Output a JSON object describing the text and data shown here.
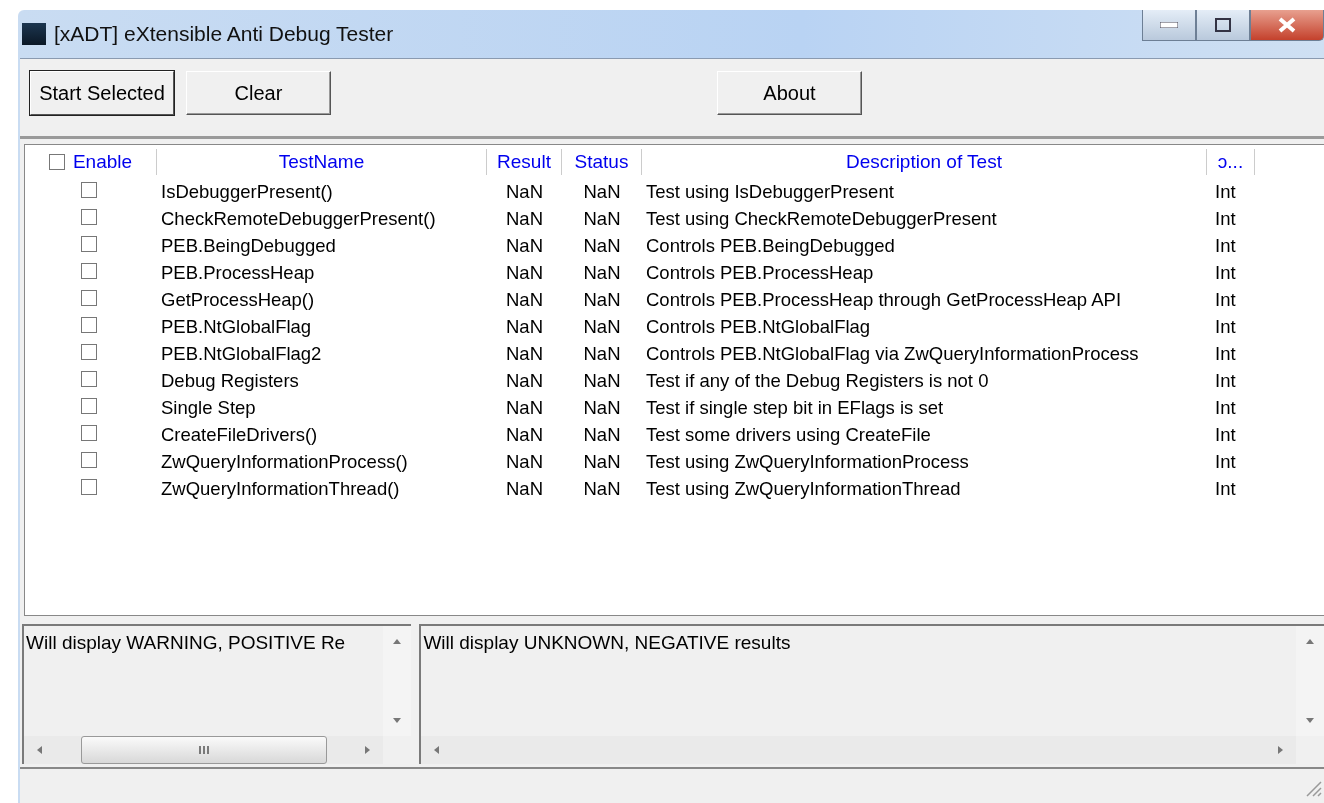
{
  "window": {
    "title": "[xADT] eXtensible Anti Debug Tester"
  },
  "toolbar": {
    "buttons": [
      {
        "label": "Start Selected",
        "focused": true
      },
      {
        "label": "Clear",
        "focused": false
      },
      {
        "label": "About",
        "focused": false
      }
    ]
  },
  "table": {
    "select_all_checked": false,
    "columns": [
      "Enable",
      "TestName",
      "Result",
      "Status",
      "Description of Test",
      "ɔ..."
    ],
    "rows": [
      {
        "checked": false,
        "name": "IsDebuggerPresent()",
        "result": "NaN",
        "status": "NaN",
        "description": "Test using IsDebuggerPresent",
        "column_6": "Int"
      },
      {
        "checked": false,
        "name": "CheckRemoteDebuggerPresent()",
        "result": "NaN",
        "status": "NaN",
        "description": "Test using CheckRemoteDebuggerPresent",
        "column_6": "Int"
      },
      {
        "checked": false,
        "name": "PEB.BeingDebugged",
        "result": "NaN",
        "status": "NaN",
        "description": "Controls PEB.BeingDebugged",
        "column_6": "Int"
      },
      {
        "checked": false,
        "name": "PEB.ProcessHeap",
        "result": "NaN",
        "status": "NaN",
        "description": "Controls PEB.ProcessHeap",
        "column_6": "Int"
      },
      {
        "checked": false,
        "name": "GetProcessHeap()",
        "result": "NaN",
        "status": "NaN",
        "description": "Controls PEB.ProcessHeap through GetProcessHeap API",
        "column_6": "Int"
      },
      {
        "checked": false,
        "name": "PEB.NtGlobalFlag",
        "result": "NaN",
        "status": "NaN",
        "description": "Controls PEB.NtGlobalFlag",
        "column_6": "Int"
      },
      {
        "checked": false,
        "name": "PEB.NtGlobalFlag2",
        "result": "NaN",
        "status": "NaN",
        "description": "Controls PEB.NtGlobalFlag via ZwQueryInformationProcess",
        "column_6": "Int"
      },
      {
        "checked": false,
        "name": "Debug Registers",
        "result": "NaN",
        "status": "NaN",
        "description": "Test if any of the Debug Registers is not 0",
        "column_6": "Int"
      },
      {
        "checked": false,
        "name": "Single Step",
        "result": "NaN",
        "status": "NaN",
        "description": "Test if single step bit in EFlags is set",
        "column_6": "Int"
      },
      {
        "checked": false,
        "name": "CreateFileDrivers()",
        "result": "NaN",
        "status": "NaN",
        "description": "Test some drivers using CreateFile",
        "column_6": "Int"
      },
      {
        "checked": false,
        "name": "ZwQueryInformationProcess()",
        "result": "NaN",
        "status": "NaN",
        "description": "Test using ZwQueryInformationProcess",
        "column_6": "Int"
      },
      {
        "checked": false,
        "name": "ZwQueryInformationThread()",
        "result": "NaN",
        "status": "NaN",
        "description": "Test using ZwQueryInformationThread",
        "column_6": "Int"
      }
    ]
  },
  "panels": [
    {
      "text": "Will display WARNING, POSITIVE Re"
    },
    {
      "text": "Will display UNKNOWN, NEGATIVE results"
    }
  ]
}
